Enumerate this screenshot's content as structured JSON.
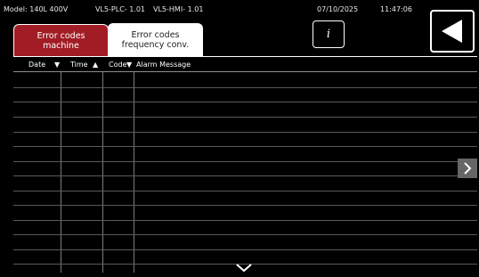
{
  "status_bar": {
    "model": "Model: 140L 400V",
    "plc_version": "VL5-PLC- 1.01",
    "hmi_version": "VL5-HMI- 1.01",
    "date": "07/10/2025",
    "time": "11:47:06"
  },
  "tabs": [
    {
      "label_line1": "Error codes",
      "label_line2": "machine",
      "active": true
    },
    {
      "label_line1": "Error codes",
      "label_line2": "frequency conv.",
      "active": false
    }
  ],
  "info_button": {
    "label": "i"
  },
  "table": {
    "columns": [
      "Date",
      "Time",
      "Code",
      "Alarm Message"
    ],
    "rows": []
  },
  "colors": {
    "background": "#000000",
    "active_tab": "#a21c25",
    "inactive_tab": "#ffffff"
  },
  "icons": {
    "back": "triangle-left",
    "info": "italic-i",
    "scroll_right": "chevron-right",
    "scroll_down": "chevron-down"
  }
}
